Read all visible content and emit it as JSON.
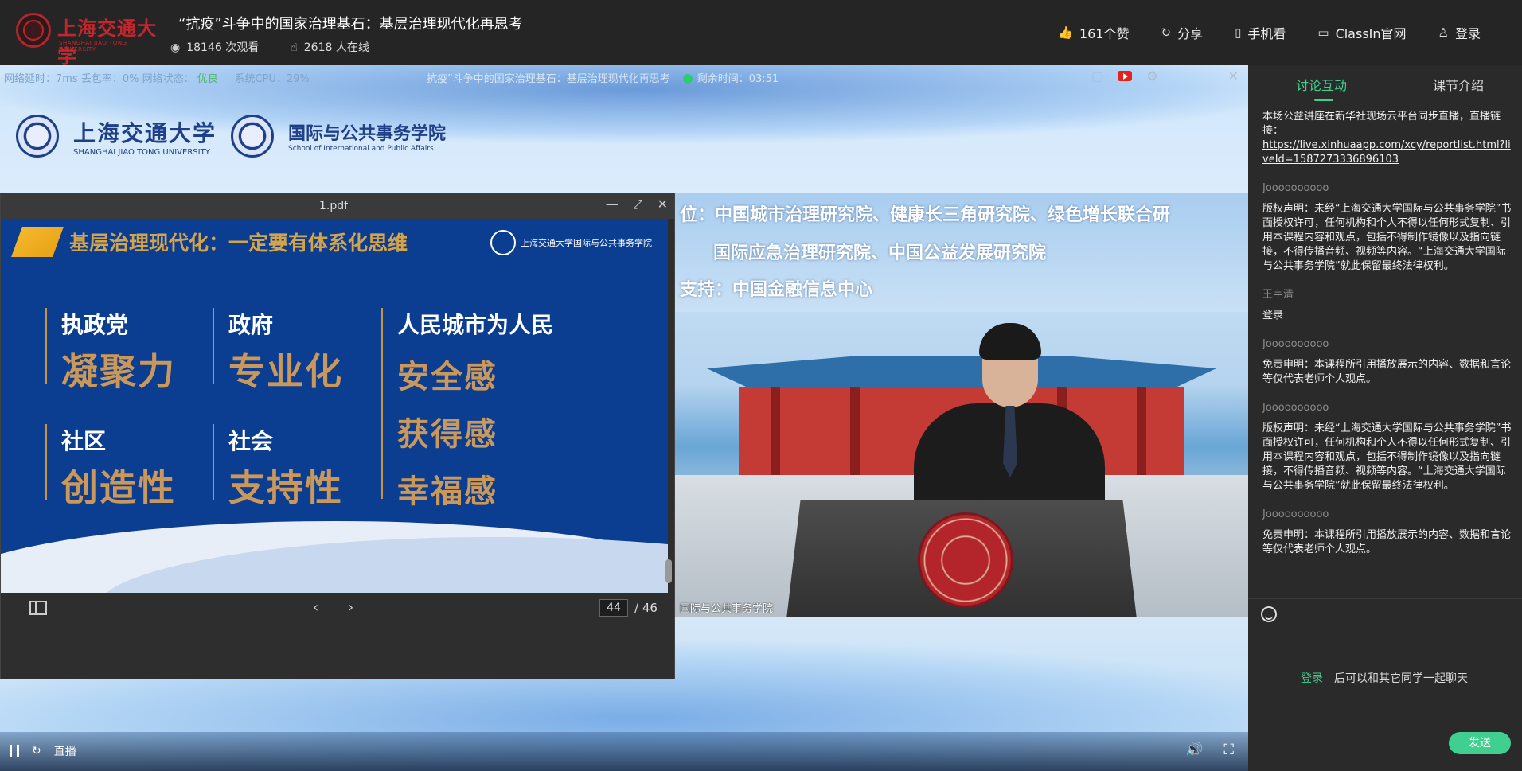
{
  "header": {
    "logo_name": "上海交通大学",
    "logo_en": "SHANGHAI JIAO TONG UNIVERSITY",
    "title": "“抗疫”斗争中的国家治理基石：基层治理现代化再思考",
    "views_count": "18146",
    "views_label": "次观看",
    "online_count": "2618",
    "online_label": "人在线",
    "links": {
      "like": "161个赞",
      "share": "分享",
      "mobile": "手机看",
      "classin": "ClassIn官网",
      "login": "登录"
    }
  },
  "stage": {
    "net_delay": "网络延时：7ms",
    "packet_loss": "丢包率：0%",
    "net_status_label": "网络状态：",
    "net_status_value": "优良",
    "cpu": "系统CPU：29%",
    "course_title": "抗疫”斗争中的国家治理基石：基层治理现代化再思考",
    "remaining": "剩余时间：03:51"
  },
  "brand": {
    "sjtu_cn": "上海交通大学",
    "sjtu_en": "SHANGHAI JIAO TONG UNIVERSITY",
    "school_cn": "国际与公共事务学院",
    "school_en": "School of International and Public Affairs"
  },
  "pdf": {
    "filename": "1.pdf",
    "slide_title": "基层治理现代化：一定要有体系化思维",
    "slide_logo": "上海交通大学国际与公共事务学院",
    "groups": [
      {
        "title": "执政党",
        "value": "凝聚力"
      },
      {
        "title": "政府",
        "value": "专业化"
      },
      {
        "title": "人民城市为人民",
        "values": [
          "安全感",
          "获得感",
          "幸福感"
        ]
      },
      {
        "title": "社区",
        "value": "创造性"
      },
      {
        "title": "社会",
        "value": "支持性"
      }
    ],
    "current_page": "44",
    "total_pages": "/ 46"
  },
  "video": {
    "banner_line1": "位：中国城市治理研究院、健康长三角研究院、绿色增长联合研",
    "banner_line2": "国际应急治理研究院、中国公益发展研究院",
    "banner_line3": "支持：中国金融信息中心",
    "label": "国际与公共事务学院"
  },
  "controls": {
    "live_label": "直播"
  },
  "panel": {
    "tab_discussion": "讨论互动",
    "tab_intro": "课节介绍",
    "messages": [
      {
        "user": "",
        "text": "本场公益讲座在新华社现场云平台同步直播，直播链接：",
        "link": "https://live.xinhuaapp.com/xcy/reportlist.html?liveId=1587273336896103"
      },
      {
        "user": "Joooooooooo",
        "text": "版权声明：未经“上海交通大学国际与公共事务学院”书面授权许可，任何机构和个人不得以任何形式复制、引用本课程内容和观点，包括不得制作镜像以及指向链接，不得传播音频、视频等内容。“上海交通大学国际与公共事务学院”就此保留最终法律权利。"
      },
      {
        "user": "王宇清",
        "text": "登录"
      },
      {
        "user": "Joooooooooo",
        "text": "免责申明：本课程所引用播放展示的内容、数据和言论等仅代表老师个人观点。"
      },
      {
        "user": "Joooooooooo",
        "text": "版权声明：未经“上海交通大学国际与公共事务学院”书面授权许可，任何机构和个人不得以任何形式复制、引用本课程内容和观点，包括不得制作镜像以及指向链接，不得传播音频、视频等内容。“上海交通大学国际与公共事务学院”就此保留最终法律权利。"
      },
      {
        "user": "Joooooooooo",
        "text": "免责申明：本课程所引用播放展示的内容、数据和言论等仅代表老师个人观点。"
      }
    ],
    "login_link": "登录",
    "login_hint": "后可以和其它同学一起聊天",
    "send": "发送"
  },
  "colors": {
    "accent_green": "#3fcf8e",
    "topbar_bg": "#252525",
    "panel_bg": "#2a2a2a",
    "slide_bg": "#0b3d91",
    "slide_gold": "#c9985a"
  }
}
